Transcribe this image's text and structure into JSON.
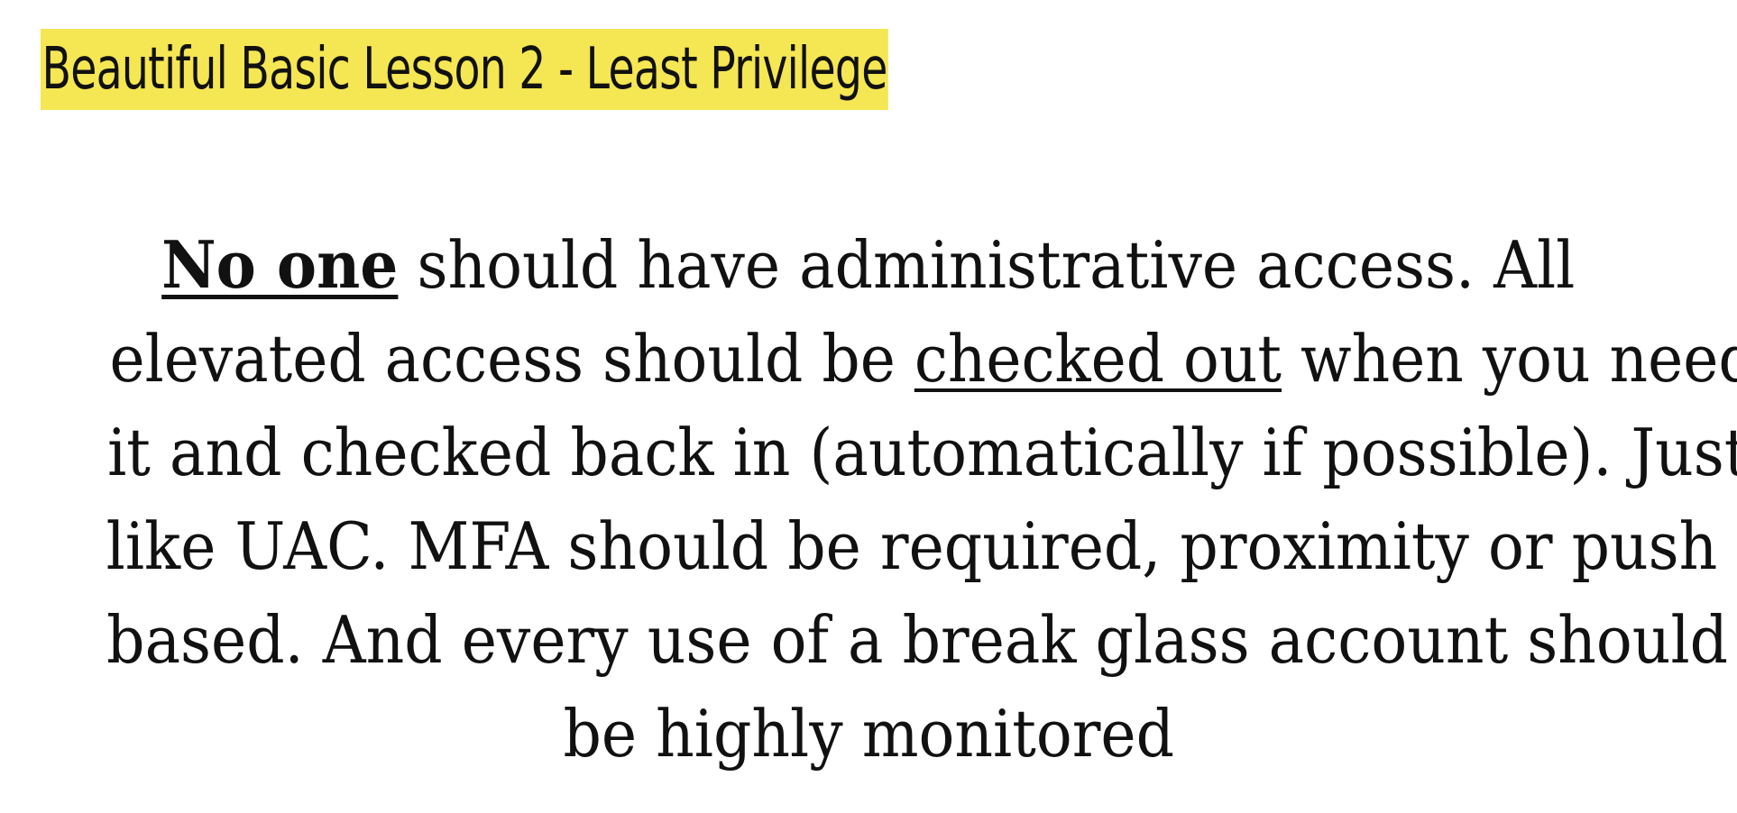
{
  "slide": {
    "title": "Beautiful Basic Lesson 2 - Least Privilege",
    "title_highlight_color": "#f5e653",
    "body": {
      "line1": {
        "emphasis": "No one",
        "rest": " should have administrative access. All"
      },
      "line2": {
        "before": "elevated access should be ",
        "underlined": "checked out",
        "after": " when you need"
      },
      "line3": "it and checked back in (automatically if possible). Just",
      "line4": "like UAC. MFA should be required, proximity or push",
      "line5": "based. And every use of a break glass account should",
      "line6": "be highly monitored"
    }
  }
}
